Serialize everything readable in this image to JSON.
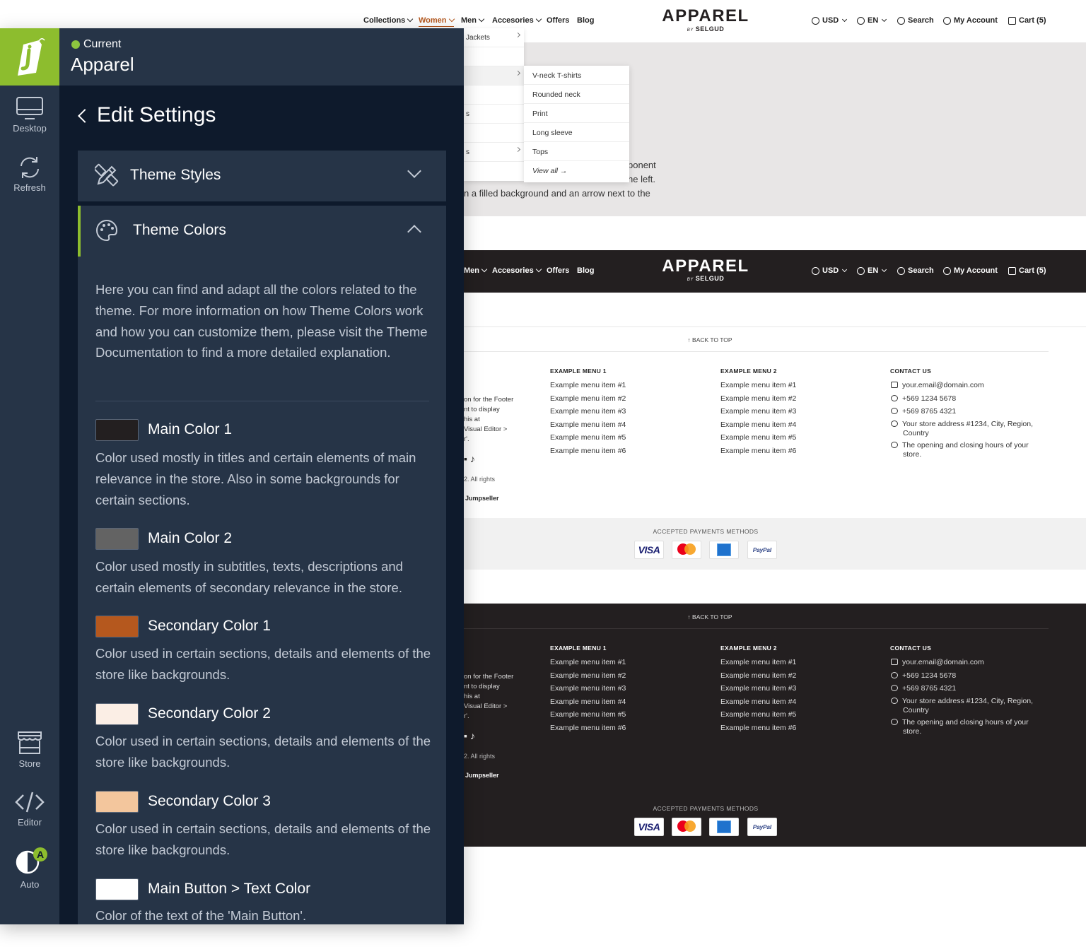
{
  "store": {
    "nav": [
      "Collections",
      "Women",
      "Men",
      "Accesories",
      "Offers",
      "Blog"
    ],
    "nav_dark": [
      "Men",
      "Accesories",
      "Offers",
      "Blog"
    ],
    "brand": "APPAREL",
    "brand_by": "BY",
    "brand_sub": "SELGUD",
    "currency": "USD",
    "language": "EN",
    "search": "Search",
    "account": "My Account",
    "cart": "Cart (5)",
    "submenu_1": [
      "Jackets"
    ],
    "submenu_2": [
      "V-neck T-shirts",
      "Rounded neck",
      "Print",
      "Long sleeve",
      "Tops",
      "View all"
    ],
    "submenu_partial": [
      "s",
      "s"
    ],
    "hero_lines": [
      "ponent",
      "he left.",
      "n a filled background and an arrow next to the"
    ],
    "back_to_top": "BACK TO TOP",
    "footer_about_lines": [
      "on for the Footer",
      "nt to display",
      "his at",
      "Visual Editor >",
      "r'."
    ],
    "footer_rights": "2. All rights",
    "footer_jumpseller": "Jumpseller",
    "menu1_title": "EXAMPLE MENU 1",
    "menu1_items": [
      "Example menu item #1",
      "Example menu item #2",
      "Example menu item #3",
      "Example menu item #4",
      "Example menu item #5",
      "Example menu item #6"
    ],
    "menu2_title": "EXAMPLE MENU 2",
    "menu2_items": [
      "Example menu item #1",
      "Example menu item #2",
      "Example menu item #3",
      "Example menu item #4",
      "Example menu item #5",
      "Example menu item #6"
    ],
    "contact_title": "CONTACT US",
    "contact_email": "your.email@domain.com",
    "contact_phone": "+569 1234 5678",
    "contact_whatsapp": "+569 8765 4321",
    "contact_address_1": "Your store address #1234, City, Region,",
    "contact_address_2": "Country",
    "contact_hours_1": "The opening and closing hours of your",
    "contact_hours_2": "store.",
    "payments_title": "ACCEPTED PAYMENTS METHODS",
    "payments": [
      "VISA",
      "mastercard",
      "AMEX",
      "PayPal"
    ]
  },
  "editor": {
    "status": "Current",
    "theme_name": "Apparel",
    "rail": {
      "desktop": "Desktop",
      "refresh": "Refresh",
      "store": "Store",
      "editor": "Editor",
      "auto": "Auto",
      "auto_badge": "A"
    },
    "title": "Edit Settings",
    "sections": {
      "styles": "Theme Styles",
      "colors": "Theme Colors"
    },
    "intro": "Here you can find and adapt all the colors related to the theme. For more information on how Theme Colors work and how you can customize them, please visit the Theme Documentation to find a more detailed explanation.",
    "colors": [
      {
        "name": "Main Color 1",
        "hex": "#231f20",
        "desc": "Color used mostly in titles and certain elements of main relevance in the store. Also in some backgrounds for certain sections."
      },
      {
        "name": "Main Color 2",
        "hex": "#636363",
        "desc": "Color used mostly in subtitles, texts, descriptions and certain elements of secondary relevance in the store."
      },
      {
        "name": "Secondary Color 1",
        "hex": "#b5581e",
        "desc": "Color used in certain sections, details and elements of the store like backgrounds."
      },
      {
        "name": "Secondary Color 2",
        "hex": "#fbeee5",
        "desc": "Color used in certain sections, details and elements of the store like backgrounds."
      },
      {
        "name": "Secondary Color 3",
        "hex": "#f3c69d",
        "desc": "Color used in certain sections, details and elements of the store like backgrounds."
      },
      {
        "name": "Main Button > Text Color",
        "hex": "#ffffff",
        "desc": "Color of the text of the 'Main Button'."
      }
    ]
  },
  "palette": {
    "accent": "#8dbd2e",
    "panel_bg": "#0e1a2c",
    "panel_card": "#263447",
    "store_dark": "#231f20",
    "store_accent": "#b5581e"
  }
}
